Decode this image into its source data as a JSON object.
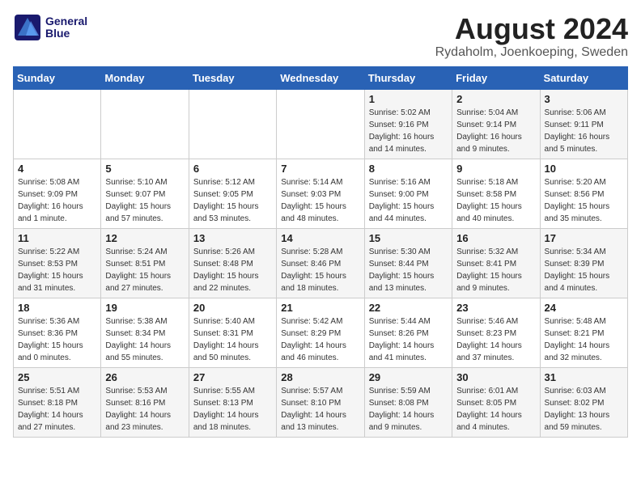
{
  "header": {
    "logo_line1": "General",
    "logo_line2": "Blue",
    "title": "August 2024",
    "subtitle": "Rydaholm, Joenkoeping, Sweden"
  },
  "weekdays": [
    "Sunday",
    "Monday",
    "Tuesday",
    "Wednesday",
    "Thursday",
    "Friday",
    "Saturday"
  ],
  "weeks": [
    [
      {
        "day": "",
        "info": ""
      },
      {
        "day": "",
        "info": ""
      },
      {
        "day": "",
        "info": ""
      },
      {
        "day": "",
        "info": ""
      },
      {
        "day": "1",
        "info": "Sunrise: 5:02 AM\nSunset: 9:16 PM\nDaylight: 16 hours\nand 14 minutes."
      },
      {
        "day": "2",
        "info": "Sunrise: 5:04 AM\nSunset: 9:14 PM\nDaylight: 16 hours\nand 9 minutes."
      },
      {
        "day": "3",
        "info": "Sunrise: 5:06 AM\nSunset: 9:11 PM\nDaylight: 16 hours\nand 5 minutes."
      }
    ],
    [
      {
        "day": "4",
        "info": "Sunrise: 5:08 AM\nSunset: 9:09 PM\nDaylight: 16 hours\nand 1 minute."
      },
      {
        "day": "5",
        "info": "Sunrise: 5:10 AM\nSunset: 9:07 PM\nDaylight: 15 hours\nand 57 minutes."
      },
      {
        "day": "6",
        "info": "Sunrise: 5:12 AM\nSunset: 9:05 PM\nDaylight: 15 hours\nand 53 minutes."
      },
      {
        "day": "7",
        "info": "Sunrise: 5:14 AM\nSunset: 9:03 PM\nDaylight: 15 hours\nand 48 minutes."
      },
      {
        "day": "8",
        "info": "Sunrise: 5:16 AM\nSunset: 9:00 PM\nDaylight: 15 hours\nand 44 minutes."
      },
      {
        "day": "9",
        "info": "Sunrise: 5:18 AM\nSunset: 8:58 PM\nDaylight: 15 hours\nand 40 minutes."
      },
      {
        "day": "10",
        "info": "Sunrise: 5:20 AM\nSunset: 8:56 PM\nDaylight: 15 hours\nand 35 minutes."
      }
    ],
    [
      {
        "day": "11",
        "info": "Sunrise: 5:22 AM\nSunset: 8:53 PM\nDaylight: 15 hours\nand 31 minutes."
      },
      {
        "day": "12",
        "info": "Sunrise: 5:24 AM\nSunset: 8:51 PM\nDaylight: 15 hours\nand 27 minutes."
      },
      {
        "day": "13",
        "info": "Sunrise: 5:26 AM\nSunset: 8:48 PM\nDaylight: 15 hours\nand 22 minutes."
      },
      {
        "day": "14",
        "info": "Sunrise: 5:28 AM\nSunset: 8:46 PM\nDaylight: 15 hours\nand 18 minutes."
      },
      {
        "day": "15",
        "info": "Sunrise: 5:30 AM\nSunset: 8:44 PM\nDaylight: 15 hours\nand 13 minutes."
      },
      {
        "day": "16",
        "info": "Sunrise: 5:32 AM\nSunset: 8:41 PM\nDaylight: 15 hours\nand 9 minutes."
      },
      {
        "day": "17",
        "info": "Sunrise: 5:34 AM\nSunset: 8:39 PM\nDaylight: 15 hours\nand 4 minutes."
      }
    ],
    [
      {
        "day": "18",
        "info": "Sunrise: 5:36 AM\nSunset: 8:36 PM\nDaylight: 15 hours\nand 0 minutes."
      },
      {
        "day": "19",
        "info": "Sunrise: 5:38 AM\nSunset: 8:34 PM\nDaylight: 14 hours\nand 55 minutes."
      },
      {
        "day": "20",
        "info": "Sunrise: 5:40 AM\nSunset: 8:31 PM\nDaylight: 14 hours\nand 50 minutes."
      },
      {
        "day": "21",
        "info": "Sunrise: 5:42 AM\nSunset: 8:29 PM\nDaylight: 14 hours\nand 46 minutes."
      },
      {
        "day": "22",
        "info": "Sunrise: 5:44 AM\nSunset: 8:26 PM\nDaylight: 14 hours\nand 41 minutes."
      },
      {
        "day": "23",
        "info": "Sunrise: 5:46 AM\nSunset: 8:23 PM\nDaylight: 14 hours\nand 37 minutes."
      },
      {
        "day": "24",
        "info": "Sunrise: 5:48 AM\nSunset: 8:21 PM\nDaylight: 14 hours\nand 32 minutes."
      }
    ],
    [
      {
        "day": "25",
        "info": "Sunrise: 5:51 AM\nSunset: 8:18 PM\nDaylight: 14 hours\nand 27 minutes."
      },
      {
        "day": "26",
        "info": "Sunrise: 5:53 AM\nSunset: 8:16 PM\nDaylight: 14 hours\nand 23 minutes."
      },
      {
        "day": "27",
        "info": "Sunrise: 5:55 AM\nSunset: 8:13 PM\nDaylight: 14 hours\nand 18 minutes."
      },
      {
        "day": "28",
        "info": "Sunrise: 5:57 AM\nSunset: 8:10 PM\nDaylight: 14 hours\nand 13 minutes."
      },
      {
        "day": "29",
        "info": "Sunrise: 5:59 AM\nSunset: 8:08 PM\nDaylight: 14 hours\nand 9 minutes."
      },
      {
        "day": "30",
        "info": "Sunrise: 6:01 AM\nSunset: 8:05 PM\nDaylight: 14 hours\nand 4 minutes."
      },
      {
        "day": "31",
        "info": "Sunrise: 6:03 AM\nSunset: 8:02 PM\nDaylight: 13 hours\nand 59 minutes."
      }
    ]
  ]
}
